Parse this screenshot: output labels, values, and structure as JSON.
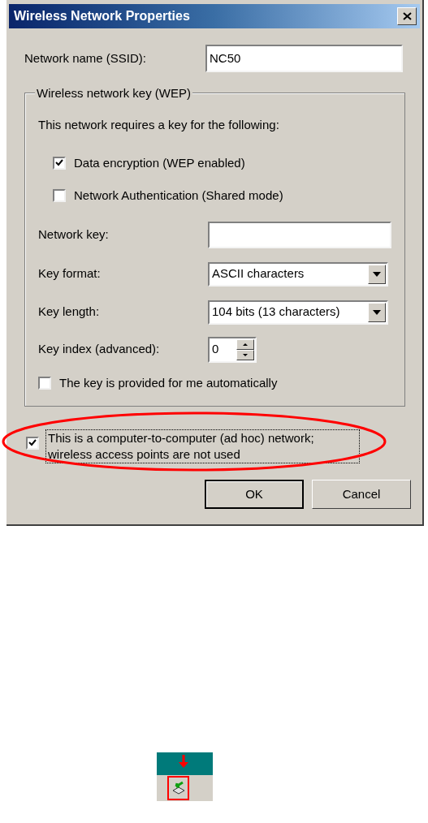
{
  "window": {
    "title": "Wireless Network Properties"
  },
  "ssid": {
    "label": "Network name (SSID):",
    "value": "NC50"
  },
  "wep_group": {
    "title": "Wireless network key (WEP)",
    "intro": "This network requires a key for the following:",
    "options": [
      {
        "label": "Data encryption (WEP enabled)",
        "checked": true
      },
      {
        "label": "Network Authentication (Shared mode)",
        "checked": false
      }
    ],
    "network_key": {
      "label": "Network key:"
    },
    "key_format": {
      "label": "Key format:",
      "value": "ASCII characters"
    },
    "key_length": {
      "label": "Key length:",
      "value": "104 bits (13 characters)"
    },
    "key_index": {
      "label": "Key index (advanced):",
      "value": "0"
    },
    "auto_key": {
      "label": "The key is provided for me automatically",
      "checked": false
    }
  },
  "adhoc": {
    "label": "This is a computer-to-computer (ad hoc) network; wireless access points are not used",
    "checked": true
  },
  "buttons": [
    "OK",
    "Cancel"
  ]
}
